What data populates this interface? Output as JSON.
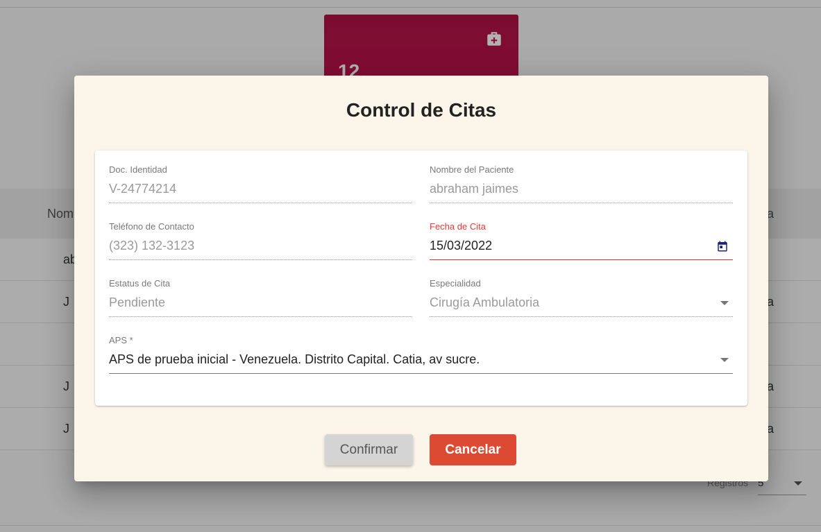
{
  "background": {
    "stat_card": {
      "value": "12",
      "icon": "first-aid-kit-icon",
      "color": "#b01246"
    },
    "table": {
      "header_left": "Nom",
      "header_right": "a",
      "rows": [
        {
          "left": "ab",
          "right": ""
        },
        {
          "left": "J",
          "right": "a"
        },
        {
          "left": "",
          "right": ""
        },
        {
          "left": "J",
          "right": "a"
        },
        {
          "left": "J",
          "right": "a"
        }
      ]
    },
    "pagination": {
      "label": "Registros",
      "value": "5"
    }
  },
  "dialog": {
    "title": "Control de Citas",
    "fields": {
      "doc_identidad": {
        "label": "Doc. Identidad",
        "value": "V-24774214"
      },
      "nombre_paciente": {
        "label": "Nombre del Paciente",
        "value": "abraham jaimes"
      },
      "telefono": {
        "label": "Teléfono de Contacto",
        "value": "(323) 132-3123"
      },
      "fecha_cita": {
        "label": "Fecha de Cita",
        "value": "15/03/2022",
        "icon": "calendar-icon"
      },
      "estatus": {
        "label": "Estatus de Cita",
        "value": "Pendiente"
      },
      "especialidad": {
        "label": "Especialidad",
        "value": "Cirugía Ambulatoria"
      },
      "aps": {
        "label": "APS *",
        "value": "APS de prueba inicial - Venezuela. Distrito Capital. Catia, av sucre."
      }
    },
    "buttons": {
      "confirm": "Confirmar",
      "cancel": "Cancelar"
    },
    "colors": {
      "dialog_bg": "#fcf5ea",
      "accent_red": "#dc4a33",
      "error_label": "#e53935",
      "calendar_icon": "#1a237e"
    }
  }
}
